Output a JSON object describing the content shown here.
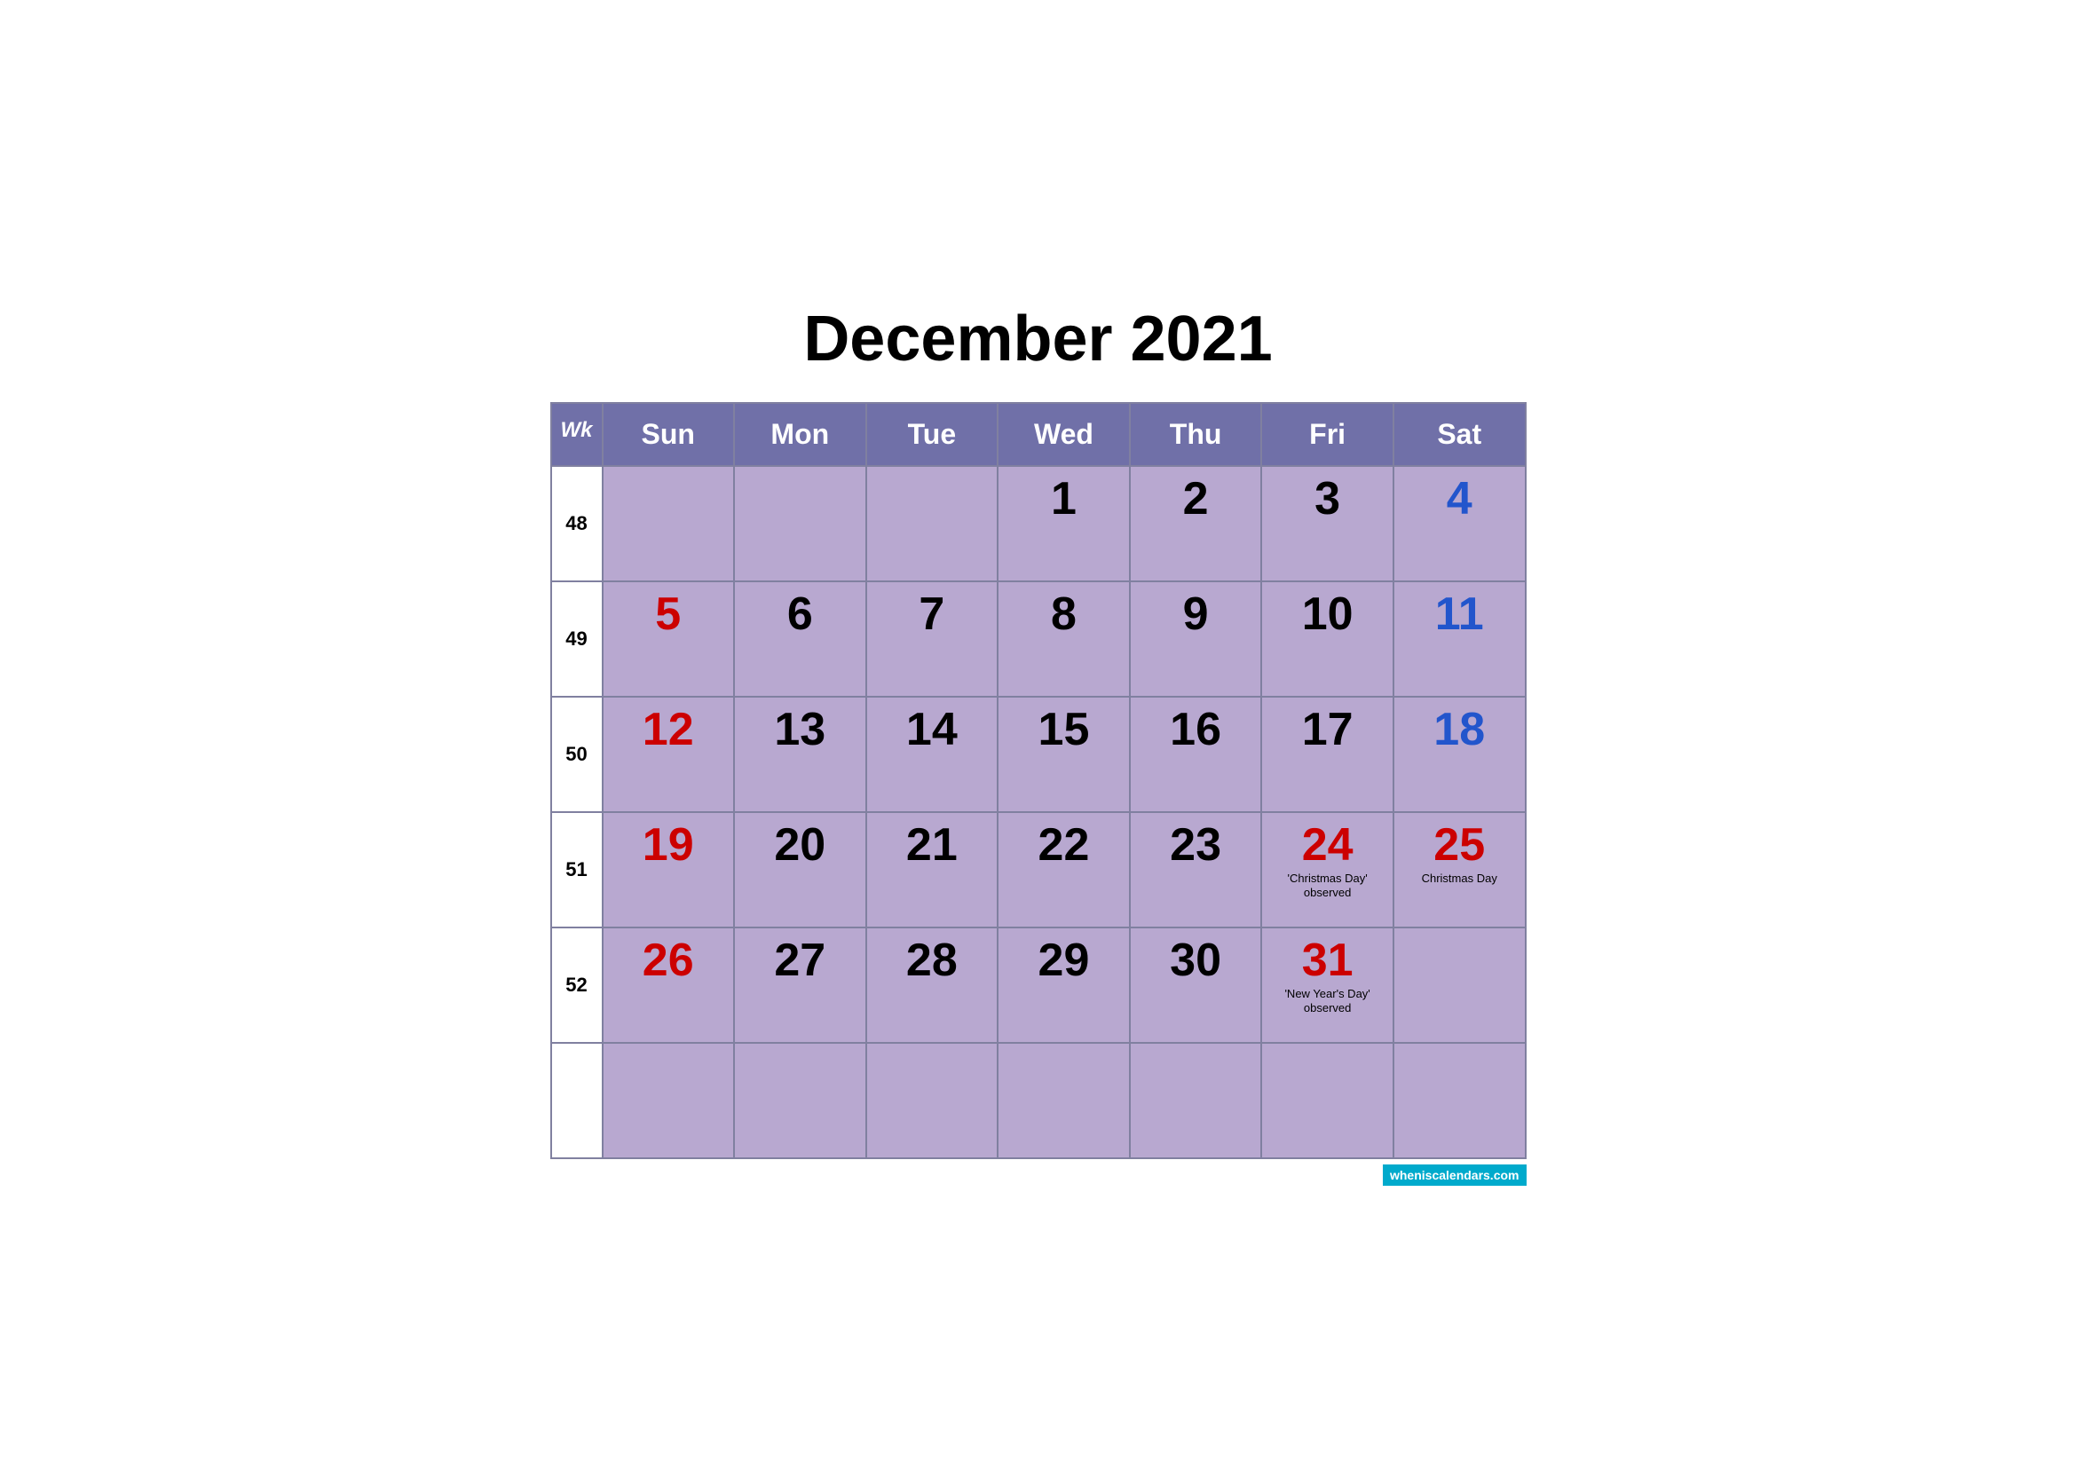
{
  "title": "December 2021",
  "headers": {
    "wk": "Wk",
    "sun": "Sun",
    "mon": "Mon",
    "tue": "Tue",
    "wed": "Wed",
    "thu": "Thu",
    "fri": "Fri",
    "sat": "Sat"
  },
  "weeks": [
    {
      "week_num": "48",
      "days": [
        {
          "day": "",
          "color": "black"
        },
        {
          "day": "",
          "color": "black"
        },
        {
          "day": "",
          "color": "black"
        },
        {
          "day": "1",
          "color": "black"
        },
        {
          "day": "2",
          "color": "black"
        },
        {
          "day": "3",
          "color": "black"
        },
        {
          "day": "4",
          "color": "blue"
        }
      ]
    },
    {
      "week_num": "49",
      "days": [
        {
          "day": "5",
          "color": "red"
        },
        {
          "day": "6",
          "color": "black"
        },
        {
          "day": "7",
          "color": "black"
        },
        {
          "day": "8",
          "color": "black"
        },
        {
          "day": "9",
          "color": "black"
        },
        {
          "day": "10",
          "color": "black"
        },
        {
          "day": "11",
          "color": "blue"
        }
      ]
    },
    {
      "week_num": "50",
      "days": [
        {
          "day": "12",
          "color": "red"
        },
        {
          "day": "13",
          "color": "black"
        },
        {
          "day": "14",
          "color": "black"
        },
        {
          "day": "15",
          "color": "black"
        },
        {
          "day": "16",
          "color": "black"
        },
        {
          "day": "17",
          "color": "black"
        },
        {
          "day": "18",
          "color": "blue"
        }
      ]
    },
    {
      "week_num": "51",
      "days": [
        {
          "day": "19",
          "color": "red"
        },
        {
          "day": "20",
          "color": "black"
        },
        {
          "day": "21",
          "color": "black"
        },
        {
          "day": "22",
          "color": "black"
        },
        {
          "day": "23",
          "color": "black"
        },
        {
          "day": "24",
          "color": "red",
          "holiday": "'Christmas Day' observed"
        },
        {
          "day": "25",
          "color": "red",
          "holiday": "Christmas Day"
        }
      ]
    },
    {
      "week_num": "52",
      "days": [
        {
          "day": "26",
          "color": "red"
        },
        {
          "day": "27",
          "color": "black"
        },
        {
          "day": "28",
          "color": "black"
        },
        {
          "day": "29",
          "color": "black"
        },
        {
          "day": "30",
          "color": "black"
        },
        {
          "day": "31",
          "color": "red",
          "holiday": "'New Year's Day' observed"
        },
        {
          "day": "",
          "color": "black"
        }
      ]
    }
  ],
  "watermark": "wheniscalendars.com"
}
